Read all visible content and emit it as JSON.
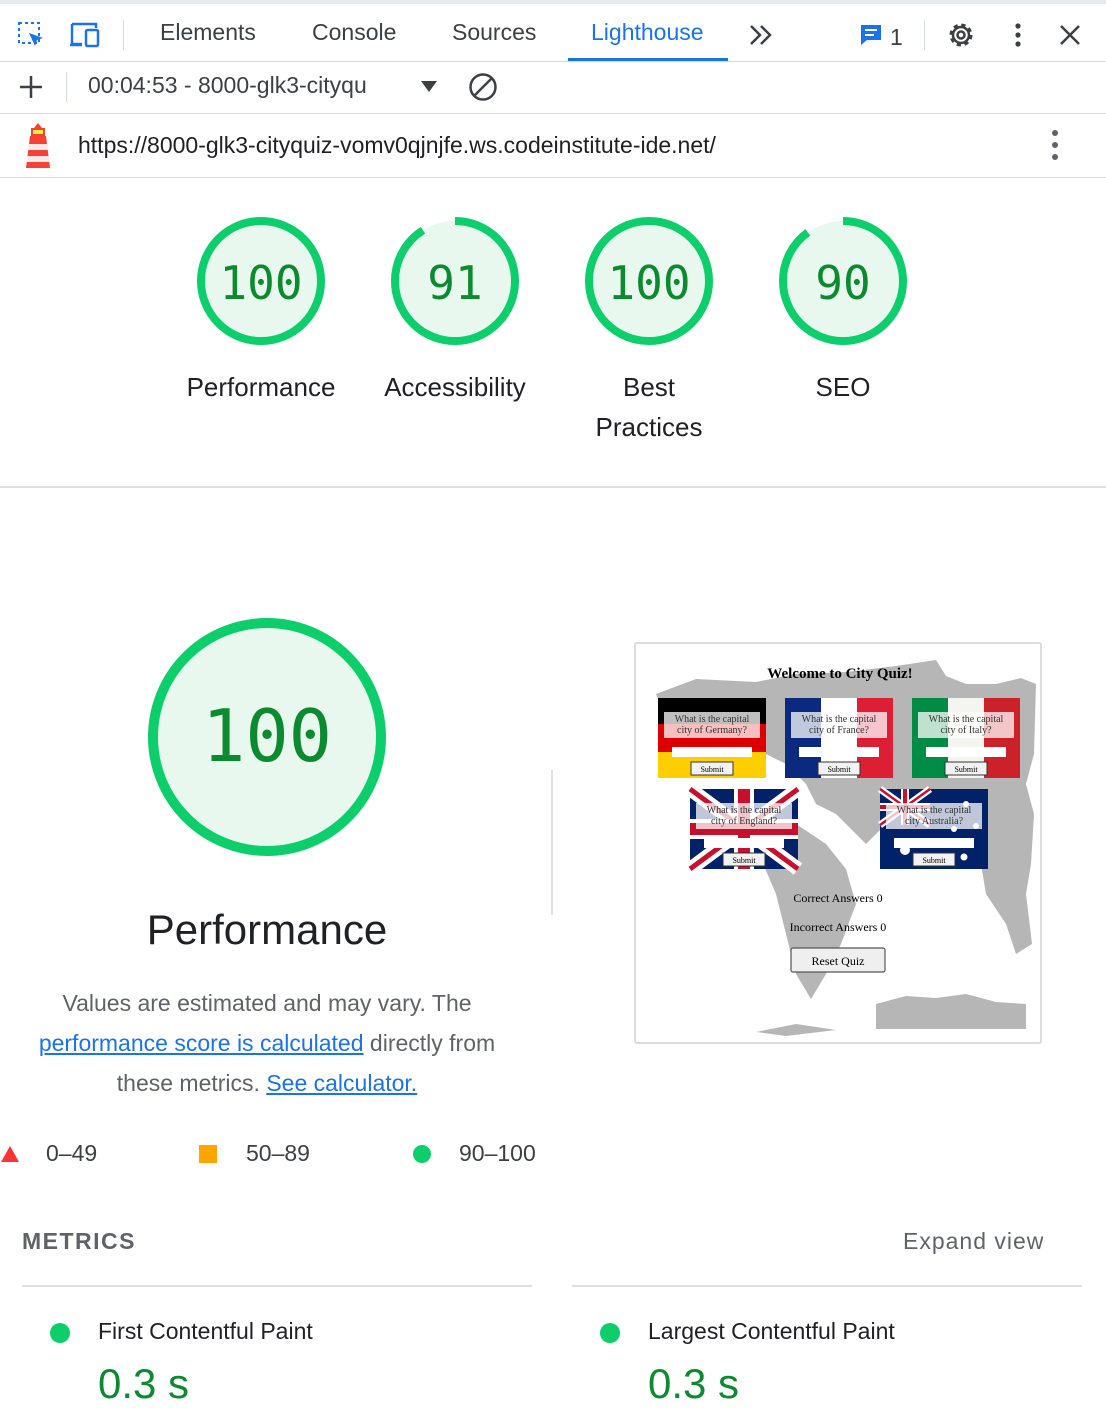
{
  "devtools": {
    "tabs": [
      "Elements",
      "Console",
      "Sources",
      "Lighthouse"
    ],
    "issue_count": "1",
    "report_select": "00:04:53 - 8000-glk3-cityqu",
    "url": "https://8000-glk3-cityquiz-vomv0qjnjfe.ws.codeinstitute-ide.net/"
  },
  "scores": [
    {
      "value": 100,
      "label": "Performance"
    },
    {
      "value": 91,
      "label": "Accessibility"
    },
    {
      "value": 100,
      "label": "Best Practices"
    },
    {
      "value": 90,
      "label": "SEO"
    }
  ],
  "performance": {
    "score": "100",
    "title": "Performance",
    "desc_1": "Values are estimated and may vary. The",
    "link_1": "performance score is calculated",
    "desc_2": " directly from these metrics. ",
    "link_2": "See calculator."
  },
  "legend": {
    "fail": "0–49",
    "average": "50–89",
    "pass": "90–100"
  },
  "thumbnail": {
    "title": "Welcome to City Quiz!",
    "q_germany": "What is the capital city of Germany?",
    "q_france": "What is the capital city of France?",
    "q_italy": "What is the capital city of Italy?",
    "q_england": "What is the capital city of England?",
    "q_australia": "What is the capital city Australia?",
    "submit": "Submit",
    "correct": "Correct Answers 0",
    "incorrect": "Incorrect Answers 0",
    "reset": "Reset Quiz"
  },
  "metrics": {
    "heading": "METRICS",
    "expand": "Expand view",
    "fcp_label": "First Contentful Paint",
    "fcp_value": "0.3 s",
    "lcp_label": "Largest Contentful Paint",
    "lcp_value": "0.3 s"
  },
  "colors": {
    "pass": "#0cce6b",
    "pass_bg": "#e8f8ef",
    "pass_text": "#0c8a2f",
    "link": "#1a73e8",
    "average": "#ffa400",
    "fail": "#ff3333"
  }
}
